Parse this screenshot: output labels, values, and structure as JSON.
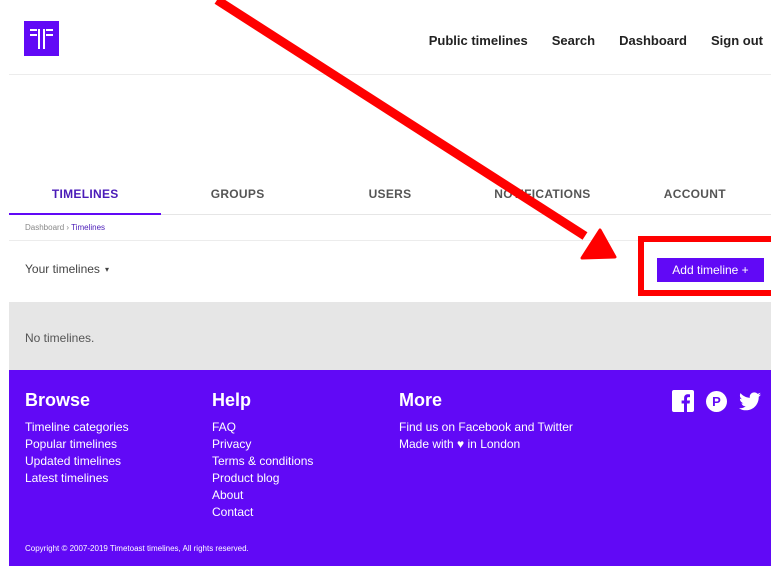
{
  "header": {
    "logo_icon": "timetoast-logo-icon",
    "nav": [
      "Public timelines",
      "Search",
      "Dashboard",
      "Sign out"
    ]
  },
  "tabs": [
    "TIMELINES",
    "GROUPS",
    "USERS",
    "NOTIFICATIONS",
    "ACCOUNT"
  ],
  "active_tab": "TIMELINES",
  "breadcrumb": {
    "parent": "Dashboard",
    "separator": "›",
    "current": "Timelines"
  },
  "filter": {
    "label": "Your timelines",
    "caret": "▾"
  },
  "add_button": "Add timeline +",
  "empty_message": "No timelines.",
  "footer": {
    "browse": {
      "title": "Browse",
      "links": [
        "Timeline categories",
        "Popular timelines",
        "Updated timelines",
        "Latest timelines"
      ]
    },
    "help": {
      "title": "Help",
      "links": [
        "FAQ",
        "Privacy",
        "Terms & conditions",
        "Product blog",
        "About",
        "Contact"
      ]
    },
    "more": {
      "title": "More",
      "line1": "Find us on Facebook and Twitter",
      "made_with_pre": "Made with",
      "made_with_post": "in London"
    },
    "social_icons": [
      "facebook-icon",
      "pinterest-icon",
      "twitter-icon"
    ],
    "copyright": "Copyright © 2007-2019 Timetoast timelines, All rights reserved."
  },
  "colors": {
    "brand": "#6109f6",
    "annotation": "#ff0000"
  }
}
